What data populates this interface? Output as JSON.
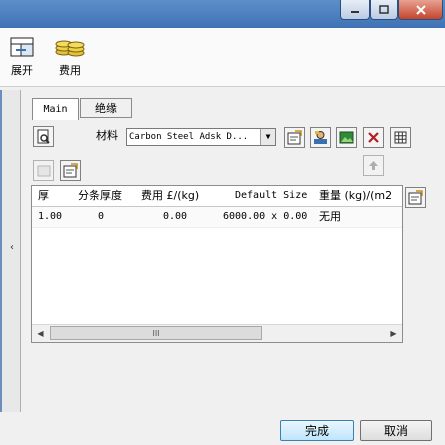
{
  "toolbar": {
    "expand_label": "展开",
    "cost_label": "费用"
  },
  "tabs": {
    "main_label": "Main",
    "insulation_label": "绝缘"
  },
  "material": {
    "label": "材料",
    "value": "Carbon Steel Adsk D..."
  },
  "grid": {
    "columns": [
      "厚",
      "分条厚度",
      "费用 £/(kg)",
      "Default Size",
      "重量 (kg)/(m2"
    ],
    "rows": [
      [
        "1.00",
        "0",
        "0.00",
        "6000.00 x 0.00",
        "无用"
      ]
    ],
    "scroll_thumb_grip": "III"
  },
  "footer": {
    "ok_label": "完成",
    "cancel_label": "取消"
  },
  "colors": {
    "titlebar": "#4a7dbe",
    "close_button": "#c4452d",
    "ok_button": "#bee6fd"
  }
}
